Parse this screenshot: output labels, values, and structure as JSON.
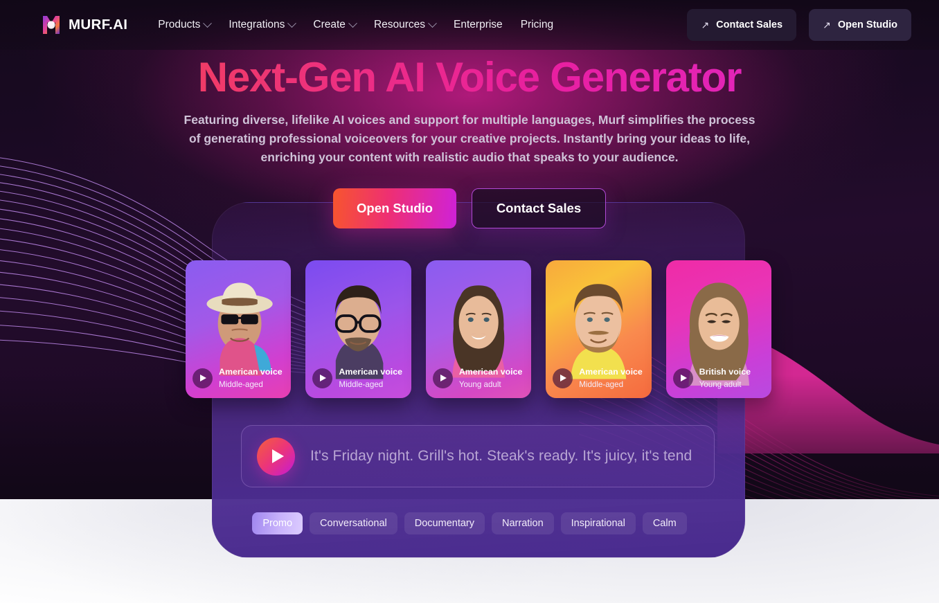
{
  "nav": {
    "brand": "MURF.AI",
    "links": [
      {
        "label": "Products",
        "has_dropdown": true
      },
      {
        "label": "Integrations",
        "has_dropdown": true
      },
      {
        "label": "Create",
        "has_dropdown": true
      },
      {
        "label": "Resources",
        "has_dropdown": true
      },
      {
        "label": "Enterprise",
        "has_dropdown": false
      },
      {
        "label": "Pricing",
        "has_dropdown": false
      }
    ],
    "contact_sales": "Contact Sales",
    "open_studio": "Open Studio",
    "arrow_glyph": "↗"
  },
  "hero": {
    "headline": "Next-Gen AI Voice Generator",
    "subhead": "Featuring diverse, lifelike AI voices and support for multiple languages, Murf simplifies the process of generating professional voiceovers for your creative projects. Instantly bring your ideas to life, enriching your content with realistic audio that speaks to your audience.",
    "primary_cta": "Open Studio",
    "secondary_cta": "Contact Sales"
  },
  "voice_cards": [
    {
      "accent": "American voice",
      "age": "Middle-aged",
      "wash": "linear-gradient(160deg,#8a5cf0 0%,#a259e8 40%,#d13fd0 75%,#e83fb2 100%)",
      "skin": "#d9a88b",
      "hair": "#7a5c43",
      "accessory": "hat"
    },
    {
      "accent": "American voice",
      "age": "Middle-aged",
      "wash": "linear-gradient(160deg,#7b4bf0 0%,#9b55ea 45%,#b94ae0 80%,#c74ddc 100%)",
      "skin": "#dcae8f",
      "hair": "#3a2b22",
      "accessory": "glasses"
    },
    {
      "accent": "American voice",
      "age": "Young adult",
      "wash": "linear-gradient(160deg,#8a5cf0 0%,#a85ce8 45%,#d648c4 85%,#e053b8 100%)",
      "skin": "#e3b596",
      "hair": "#553c2c",
      "accessory": "none"
    },
    {
      "accent": "American voice",
      "age": "Middle-aged",
      "wash": "linear-gradient(150deg,#f8a93c 0%,#f9c13a 28%,#f98a4e 62%,#f56a3e 100%)",
      "skin": "#e9bc9b",
      "hair": "#6a4a32",
      "accessory": "beard"
    },
    {
      "accent": "British voice",
      "age": "Young adult",
      "wash": "linear-gradient(160deg,#ef2ba6 0%,#e934b6 35%,#c93fd8 75%,#b84ae0 100%)",
      "skin": "#e5b894",
      "hair": "#8a6a4a",
      "accessory": "long-hair"
    }
  ],
  "script_bar": {
    "text": "It's Friday night. Grill's hot. Steak's ready. It's juicy, it's tend",
    "play_label": "play-script"
  },
  "style_tabs": [
    {
      "label": "Promo",
      "active": true
    },
    {
      "label": "Conversational",
      "active": false
    },
    {
      "label": "Documentary",
      "active": false
    },
    {
      "label": "Narration",
      "active": false
    },
    {
      "label": "Inspirational",
      "active": false
    },
    {
      "label": "Calm",
      "active": false
    }
  ],
  "colors": {
    "hero_bg": "#190a22",
    "accent_pink": "#ec2e83",
    "accent_magenta": "#d92ec6",
    "accent_orange": "#f7552e",
    "panel_purple": "#4d2d91",
    "tab_active": "#c9b3fb",
    "wave_left": "#b07ae6",
    "wave_right": "#ee2da2"
  }
}
